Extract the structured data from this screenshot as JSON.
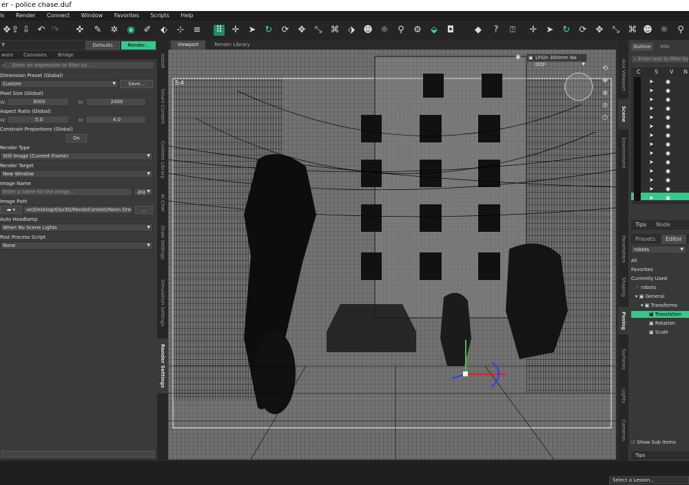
{
  "window_title": "er - police chase.duf",
  "menu": [
    "ls",
    "Render",
    "Connect",
    "Window",
    "Favorites",
    "Scripts",
    "Help"
  ],
  "left_panel": {
    "top_buttons": {
      "defaults": "Defaults",
      "render": "Render..."
    },
    "tabs": [
      "ware",
      "Canvases",
      "Bridge"
    ],
    "filter_placeholder": "Enter an expression to filter by...",
    "dimension_preset_label": "Dimension Preset (Global)",
    "dimension_preset_value": "Custom",
    "save_label": "Save...",
    "pixel_size_label": "Pixel Size (Global)",
    "w_label": "W:",
    "h_label": "H:",
    "width": "3000",
    "height": "2400",
    "aspect_label": "Aspect Ratio (Global)",
    "aspect_w": "5.0",
    "aspect_h": "4.0",
    "constrain_label": "Constrain Proportions (Global)",
    "constrain_value": "On",
    "render_type_label": "Render Type",
    "render_type_value": "Still Image (Current Frame)",
    "render_target_label": "Render Target",
    "render_target_value": "New Window",
    "image_name_label": "Image Name",
    "image_name_placeholder": "Enter a name for the image...",
    "image_ext": ".jpg",
    "image_path_label": "Image Path",
    "image_path_value": "ve/Desktop/Daz3D/RendoContest/Neon Dreams",
    "path_more": "...",
    "auto_headlamp_label": "Auto Headlamp",
    "auto_headlamp_value": "When No Scene Lights",
    "post_script_label": "Post Process Script",
    "post_script_value": "None"
  },
  "side_tabs_left": [
    "Install",
    "Smart Content",
    "Content Library",
    "AI Chat",
    "Draw Settings",
    "Simulation Settings",
    "Render Settings"
  ],
  "viewport": {
    "tabs": [
      "Viewport",
      "Render Library"
    ],
    "camera": "LFSin 300mm No DOF",
    "ratio_label": "5:4"
  },
  "right_side_tabs": [
    "Aux Viewport",
    "Scene",
    "Environment",
    "Parameters",
    "Shaping",
    "Posing",
    "Surfaces",
    "Lights",
    "Cameras"
  ],
  "right_panel": {
    "top_tabs": [
      "Outline",
      "Info"
    ],
    "filter_placeholder": "Enter text to filter by",
    "columns": [
      "C",
      "S",
      "V",
      "N"
    ],
    "tips_tabs": [
      "Tips",
      "Node"
    ],
    "editor_tabs": [
      "Presets",
      "Editor"
    ],
    "node_select": "robots",
    "filter_items": [
      "All",
      "Favorites",
      "Currently Used"
    ],
    "tree": [
      "robots",
      "General",
      "Transforms",
      "Translation",
      "Rotation",
      "Scale"
    ],
    "show_sub_items": "Show Sub Items",
    "bottom_tip": "Tips"
  },
  "status": {
    "lesson": "Select a Lesson..."
  }
}
